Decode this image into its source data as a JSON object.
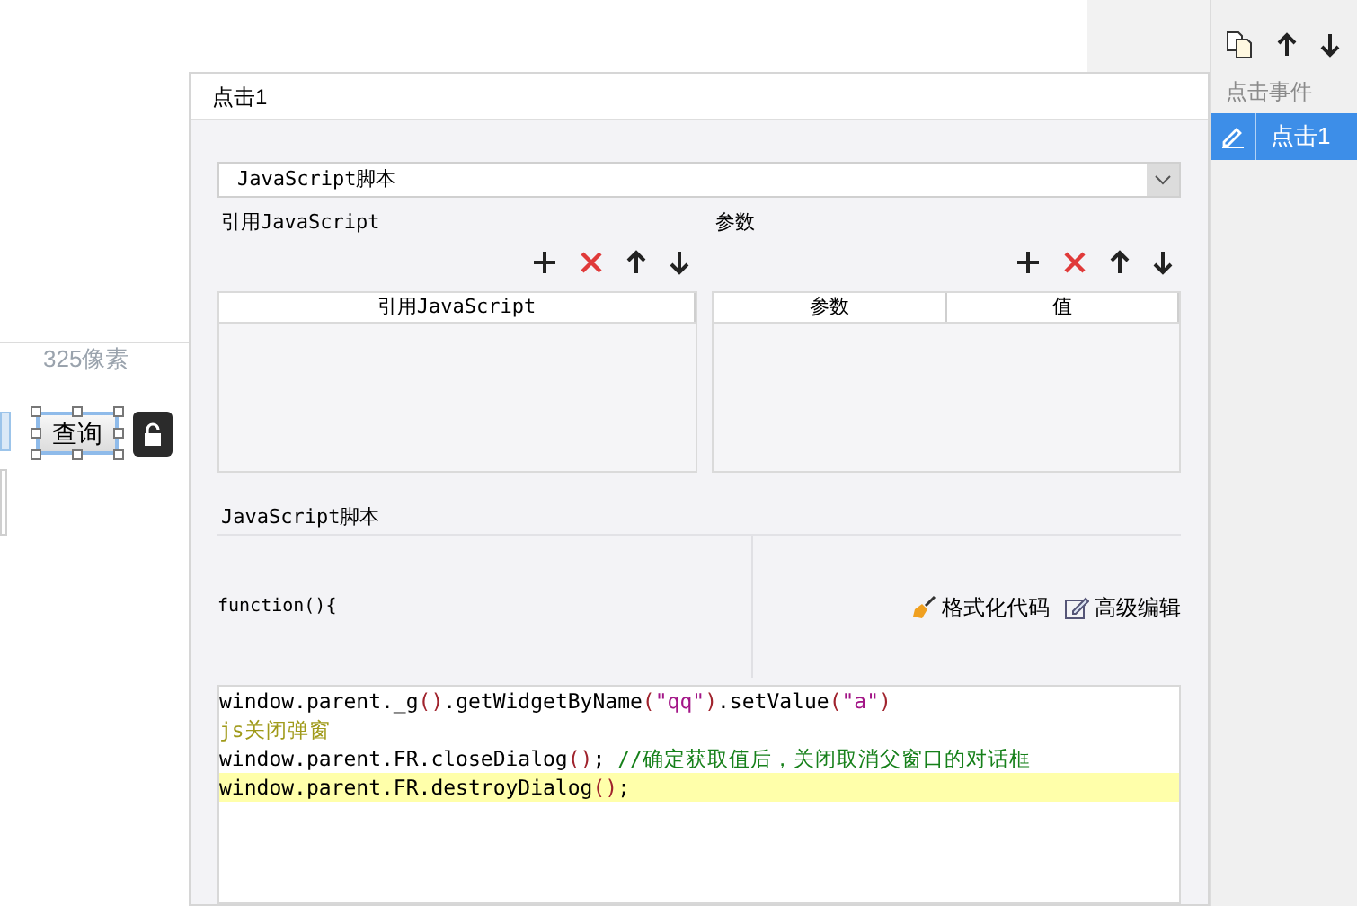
{
  "canvas": {
    "size_label": "325像素",
    "button": {
      "label": "查询",
      "selected": true
    }
  },
  "event_panel": {
    "section_label": "点击事件",
    "items": [
      {
        "label": "点击1",
        "selected": true
      }
    ]
  },
  "dialog": {
    "title": "点击1",
    "type_select": {
      "value": "JavaScript脚本"
    },
    "imports": {
      "label": "引用JavaScript",
      "columns": [
        "引用JavaScript"
      ]
    },
    "params": {
      "label": "参数",
      "columns": [
        "参数",
        "值"
      ]
    },
    "script": {
      "label": "JavaScript脚本",
      "header": "function(){",
      "format_button": "格式化代码",
      "advanced_button": "高级编辑",
      "lines": [
        {
          "highlighted": false,
          "tokens": [
            {
              "kind": "plain",
              "text": "window.parent._g"
            },
            {
              "kind": "paren",
              "text": "()"
            },
            {
              "kind": "plain",
              "text": ".getWidgetByName"
            },
            {
              "kind": "paren",
              "text": "("
            },
            {
              "kind": "string",
              "text": "\"qq\""
            },
            {
              "kind": "paren",
              "text": ")"
            },
            {
              "kind": "plain",
              "text": ".setValue"
            },
            {
              "kind": "paren",
              "text": "("
            },
            {
              "kind": "string",
              "text": "\"a\""
            },
            {
              "kind": "paren",
              "text": ")"
            }
          ]
        },
        {
          "highlighted": false,
          "tokens": [
            {
              "kind": "note",
              "text": "js关闭弹窗"
            }
          ]
        },
        {
          "highlighted": false,
          "tokens": [
            {
              "kind": "plain",
              "text": "window.parent.FR.closeDialog"
            },
            {
              "kind": "paren",
              "text": "()"
            },
            {
              "kind": "plain",
              "text": "; "
            },
            {
              "kind": "comment",
              "text": "//确定获取值后，关闭取消父窗口的对话框"
            }
          ]
        },
        {
          "highlighted": true,
          "tokens": [
            {
              "kind": "plain",
              "text": "window.parent.FR.destroyDialog"
            },
            {
              "kind": "paren",
              "text": "()"
            },
            {
              "kind": "plain",
              "text": ";"
            }
          ]
        }
      ]
    }
  }
}
